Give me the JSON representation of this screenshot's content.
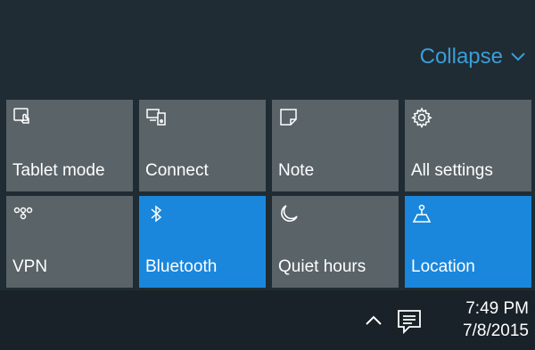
{
  "collapse": {
    "label": "Collapse"
  },
  "tiles": [
    {
      "label": "Tablet mode",
      "icon": "tablet-mode-icon",
      "active": false
    },
    {
      "label": "Connect",
      "icon": "connect-icon",
      "active": false
    },
    {
      "label": "Note",
      "icon": "note-icon",
      "active": false
    },
    {
      "label": "All settings",
      "icon": "gear-icon",
      "active": false
    },
    {
      "label": "VPN",
      "icon": "vpn-icon",
      "active": false
    },
    {
      "label": "Bluetooth",
      "icon": "bluetooth-icon",
      "active": true
    },
    {
      "label": "Quiet hours",
      "icon": "moon-icon",
      "active": false
    },
    {
      "label": "Location",
      "icon": "location-icon",
      "active": true
    }
  ],
  "taskbar": {
    "time": "7:49 PM",
    "date": "7/8/2015"
  },
  "colors": {
    "accent": "#1a87dc",
    "link": "#3a9ed8",
    "tile": "#596368",
    "background": "#1f2c33",
    "taskbar": "#182228"
  }
}
